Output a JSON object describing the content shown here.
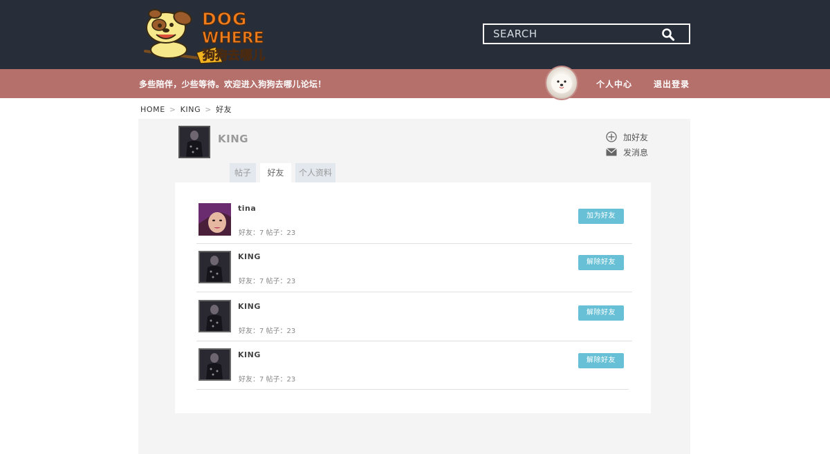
{
  "header": {
    "logo": {
      "title": "DOG WHERE",
      "subtitle": "狗狗去哪儿"
    },
    "search": {
      "placeholder": "SEARCH",
      "value": ""
    }
  },
  "subbar": {
    "welcome": "多些陪伴，少些等待。欢迎进入狗狗去哪儿论坛！",
    "nav": {
      "personal_center": "个人中心",
      "logout": "退出登录"
    }
  },
  "breadcrumb": {
    "home": "HOME",
    "user": "KING",
    "current": "好友",
    "separator": ">"
  },
  "profile": {
    "name": "KING",
    "actions": {
      "add_friend": "加好友",
      "send_message": "发消息"
    }
  },
  "tabs": [
    {
      "label": "帖子",
      "active": false
    },
    {
      "label": "好友",
      "active": true
    },
    {
      "label": "个人资料",
      "active": false
    }
  ],
  "friends": [
    {
      "name": "tina",
      "stats": "好友：7  帖子：23",
      "button": "加为好友",
      "avatar": "girl-avatar"
    },
    {
      "name": "KING",
      "stats": "好友：7  帖子：23",
      "button": "解除好友",
      "avatar": "king-avatar"
    },
    {
      "name": "KING",
      "stats": "好友：7  帖子：23",
      "button": "解除好友",
      "avatar": "king-avatar"
    },
    {
      "name": "KING",
      "stats": "好友：7  帖子：23",
      "button": "解除好友",
      "avatar": "king-avatar"
    }
  ],
  "colors": {
    "header_bg": "#272e3a",
    "subbar_bg": "#b5706c",
    "button_bg": "#67c0d6",
    "panel_bg": "#f4f4f4"
  },
  "icons": {
    "search": "search-icon",
    "add_friend": "plus-circle-icon",
    "message": "envelope-icon"
  }
}
